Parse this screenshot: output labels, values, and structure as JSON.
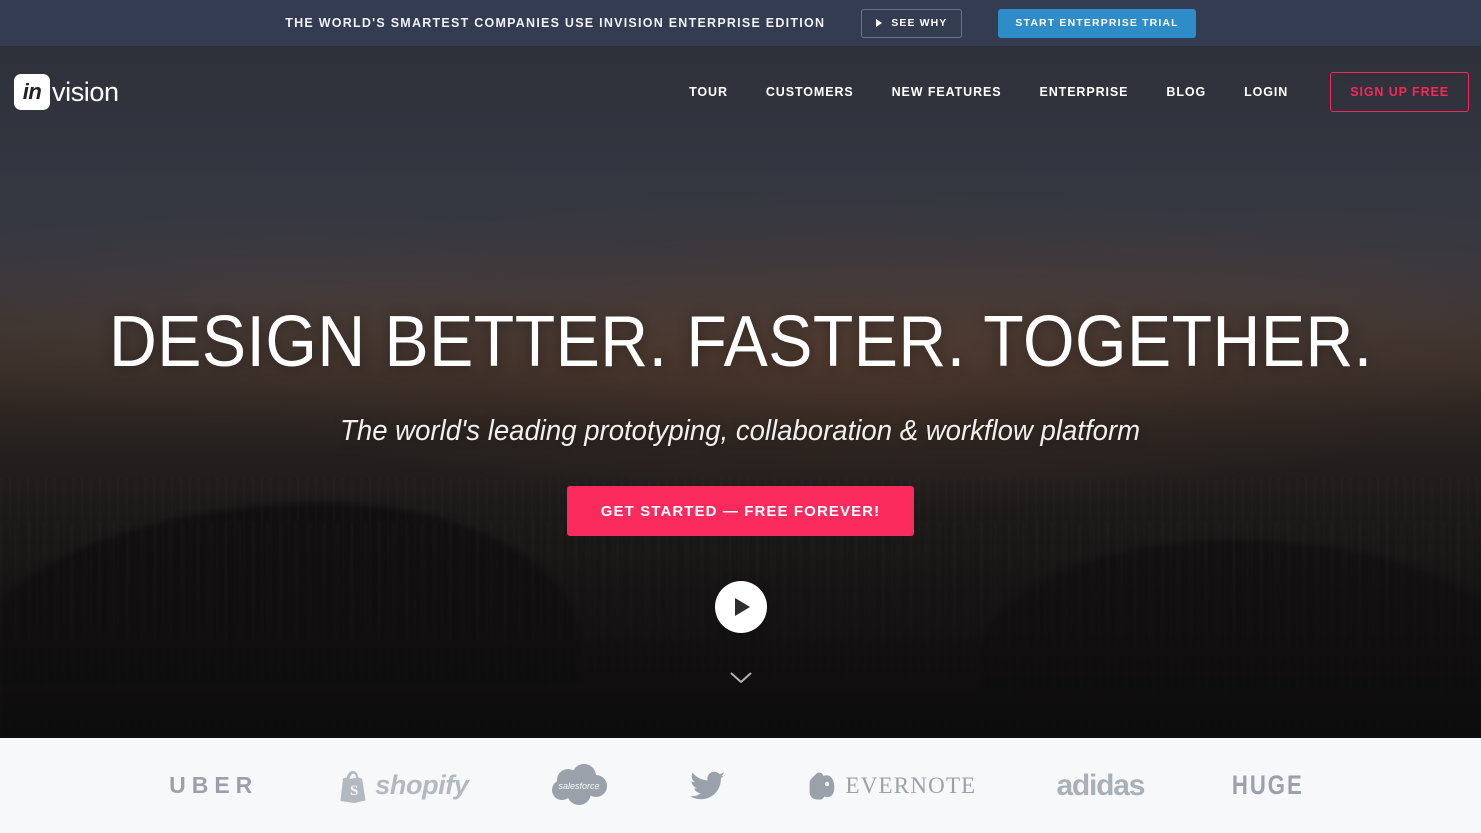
{
  "announcement": {
    "text": "THE WORLD'S SMARTEST COMPANIES USE INVISION ENTERPRISE EDITION",
    "see_why_label": "SEE WHY",
    "trial_label": "START ENTERPRISE TRIAL",
    "bar_color": "#333C50",
    "trial_color": "#2E8DC8"
  },
  "brand": {
    "mark_text": "in",
    "word_text": "vision"
  },
  "nav": {
    "items": [
      {
        "label": "TOUR"
      },
      {
        "label": "CUSTOMERS"
      },
      {
        "label": "NEW FEATURES"
      },
      {
        "label": "ENTERPRISE"
      },
      {
        "label": "BLOG"
      },
      {
        "label": "LOGIN"
      }
    ],
    "signup_label": "SIGN UP FREE",
    "signup_color": "#F8275A"
  },
  "hero": {
    "headline": "DESIGN BETTER. FASTER. TOGETHER.",
    "subheadline": "The world's leading prototyping, collaboration & workflow platform",
    "cta_label": "GET STARTED — FREE FOREVER!",
    "cta_color": "#FA2A5C",
    "play_icon": "play-icon",
    "scroll_icon": "chevron-down-icon"
  },
  "logos": {
    "items": [
      {
        "name": "uber",
        "label": "UBER"
      },
      {
        "name": "shopify",
        "label": "shopify"
      },
      {
        "name": "salesforce",
        "label": "salesforce"
      },
      {
        "name": "twitter",
        "label": ""
      },
      {
        "name": "evernote",
        "label": "EVERNOTE"
      },
      {
        "name": "adidas",
        "label": "adidas"
      },
      {
        "name": "huge",
        "label": "HUGE"
      }
    ],
    "background": "#F7F8F9",
    "color": "#9AA1AB"
  }
}
